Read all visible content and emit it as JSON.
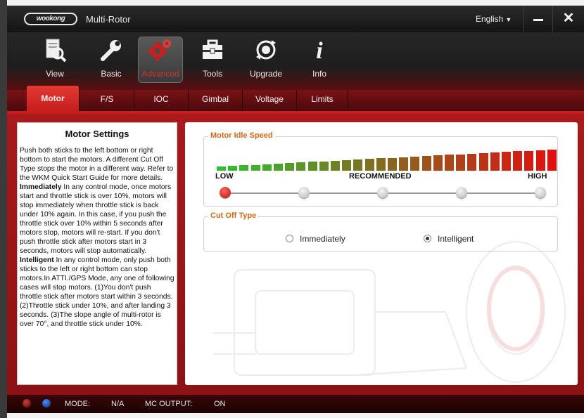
{
  "window": {
    "logo_text": "wookong",
    "title": "Multi-Rotor",
    "language": "English",
    "close_symbol": "✕"
  },
  "toolbar": {
    "items": [
      {
        "label": "View",
        "icon": "view-icon"
      },
      {
        "label": "Basic",
        "icon": "wrench-icon"
      },
      {
        "label": "Advanced",
        "icon": "gears-icon",
        "active": true
      },
      {
        "label": "Tools",
        "icon": "toolbox-icon"
      },
      {
        "label": "Upgrade",
        "icon": "upgrade-icon"
      },
      {
        "label": "Info",
        "icon": "info-icon"
      }
    ]
  },
  "subtabs": {
    "items": [
      {
        "label": "Motor",
        "active": true
      },
      {
        "label": "F/S"
      },
      {
        "label": "IOC"
      },
      {
        "label": "Gimbal"
      },
      {
        "label": "Voltage"
      },
      {
        "label": "Limits"
      }
    ]
  },
  "help": {
    "title": "Motor Settings",
    "intro": "Push both sticks to the left bottom or right bottom to start the motors. A different Cut Off Type stops the motor in a different way. Refer to the WKM Quick Start Guide for more details.",
    "immediately_head": "Immediately",
    "immediately_text": " In any control mode, once motors start and throttle stick is over 10%, motors will stop immediately when throttle stick is back under 10% again. In this case, if you push the throttle stick over 10% within 5 seconds after motors stop, motors will re-start. If you don't push throttle stick after motors start in 3 seconds, motors will stop automatically.",
    "intelligent_head": "Intelligent",
    "intelligent_text": " In any control mode, only push both sticks to the left or right bottom can stop motors.In ATTI./GPS Mode, any one of following cases will stop motors. (1)You don't push throttle stick after motors start within 3 seconds. (2)Throttle stick under 10%, and after landing 3 seconds. (3)The slope angle of multi-rotor is over 70°, and throttle stick under 10%."
  },
  "idle_speed": {
    "label": "Motor Idle Speed",
    "low_label": "LOW",
    "recommended_label": "RECOMMENDED",
    "high_label": "HIGH",
    "levels": 5,
    "selected_level": 1
  },
  "cut_off": {
    "label": "Cut Off Type",
    "options": [
      {
        "label": "Immediately",
        "selected": false
      },
      {
        "label": "Intelligent",
        "selected": true
      }
    ]
  },
  "status": {
    "mode_label": "MODE:",
    "mode_value": "N/A",
    "mc_output_label": "MC OUTPUT:",
    "mc_output_value": "ON"
  },
  "colors": {
    "accent_red": "#c81e1e",
    "group_label_orange": "#d0681a",
    "bar_low_green": "#2fc02f",
    "bar_high_red": "#e01010"
  }
}
